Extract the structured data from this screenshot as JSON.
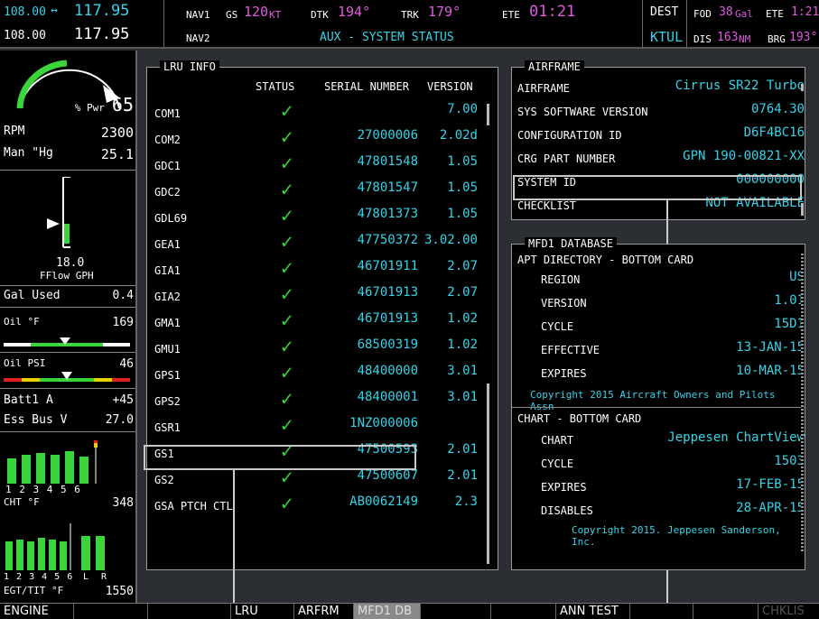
{
  "topbar": {
    "com_active_1": "108.00",
    "com_arrow": "↔",
    "com_standby_1": "117.95",
    "com_active_2": "108.00",
    "com_standby_2": "117.95",
    "nav1_label": "NAV1",
    "nav2_label": "NAV2",
    "gs_label": "GS",
    "gs_value": "120",
    "gs_unit": "KT",
    "dtk_label": "DTK",
    "dtk_value": "194°",
    "trk_label": "TRK",
    "trk_value": "179°",
    "ete_label": "ETE",
    "ete_value": "01:21",
    "page_title": "AUX - SYSTEM STATUS",
    "dest_label": "DEST",
    "dest_value": "KTUL",
    "fod_label": "FOD",
    "fod_value": "38",
    "fod_unit": "Gal",
    "ete2_label": "ETE",
    "ete2_value": "1:21",
    "dis_label": "DIS",
    "dis_value": "163",
    "dis_unit": "NM",
    "brg_label": "BRG",
    "brg_value": "193°"
  },
  "engine": {
    "pwr_label": "% Pwr",
    "pwr_value": "65",
    "rpm_label": "RPM",
    "rpm_value": "2300",
    "man_label": "Man \"Hg",
    "man_value": "25.1",
    "fflow_value": "18.0",
    "fflow_label": "FFlow GPH",
    "gal_used_label": "Gal Used",
    "gal_used_value": "0.4",
    "oil_f_label": "Oil °F",
    "oil_f_value": "169",
    "oil_psi_label": "Oil PSI",
    "oil_psi_value": "46",
    "batt_label": "Batt1 A",
    "batt_value": "+45",
    "ess_label": "Ess Bus V",
    "ess_value": "27.0",
    "cyl_labels": "1 2 3 4 5 6",
    "cht_label": "CHT °F",
    "cht_value": "348",
    "egt_cyl_labels": "1 2 3 4 5 6",
    "egt_lr": "L R",
    "egt_label": "EGT/TIT °F",
    "egt_value": "1550"
  },
  "lru": {
    "title": "LRU INFO",
    "col_status": "STATUS",
    "col_serial": "SERIAL NUMBER",
    "col_version": "VERSION",
    "check": "✓",
    "rows": [
      {
        "name": "COM1",
        "serial": "",
        "version": "7.00"
      },
      {
        "name": "COM2",
        "serial": "27000006",
        "version": "2.02d"
      },
      {
        "name": "GDC1",
        "serial": "47801548",
        "version": "1.05"
      },
      {
        "name": "GDC2",
        "serial": "47801547",
        "version": "1.05"
      },
      {
        "name": "GDL69",
        "serial": "47801373",
        "version": "1.05"
      },
      {
        "name": "GEA1",
        "serial": "47750372",
        "version": "3.02.00"
      },
      {
        "name": "GIA1",
        "serial": "46701911",
        "version": "2.07"
      },
      {
        "name": "GIA2",
        "serial": "46701913",
        "version": "2.07"
      },
      {
        "name": "GMA1",
        "serial": "46701913",
        "version": "1.02"
      },
      {
        "name": "GMU1",
        "serial": "68500319",
        "version": "1.02"
      },
      {
        "name": "GPS1",
        "serial": "48400000",
        "version": "3.01"
      },
      {
        "name": "GPS2",
        "serial": "48400001",
        "version": "3.01"
      },
      {
        "name": "GSR1",
        "serial": "1NZ000006",
        "version": ""
      },
      {
        "name": "GS1",
        "serial": "47500593",
        "version": "2.01"
      },
      {
        "name": "GS2",
        "serial": "47500607",
        "version": "2.01"
      },
      {
        "name": "GSA PTCH CTL",
        "serial": "AB0062149",
        "version": "2.3"
      }
    ]
  },
  "airframe": {
    "title": "AIRFRAME",
    "rows": [
      {
        "key": "AIRFRAME",
        "value": "Cirrus SR22 Turbo"
      },
      {
        "key": "SYS SOFTWARE VERSION",
        "value": "0764.30"
      },
      {
        "key": "CONFIGURATION ID",
        "value": "D6F4BC16"
      },
      {
        "key": "CRG PART NUMBER",
        "value": "GPN 190-00821-XX"
      },
      {
        "key": "SYSTEM ID",
        "value": "000000000"
      },
      {
        "key": "CHECKLIST",
        "value": "NOT AVAILABLE"
      }
    ]
  },
  "mfd_db": {
    "title": "MFD1 DATABASE",
    "apt_header": "APT DIRECTORY - BOTTOM CARD",
    "apt_rows": [
      {
        "key": "REGION",
        "value": "US"
      },
      {
        "key": "VERSION",
        "value": "1.01"
      },
      {
        "key": "CYCLE",
        "value": "15D1"
      },
      {
        "key": "EFFECTIVE",
        "value": "13-JAN-15"
      },
      {
        "key": "EXPIRES",
        "value": "10-MAR-15"
      }
    ],
    "apt_copyright": "Copyright 2015 Aircraft Owners and Pilots Assn",
    "chart_header": "CHART - BOTTOM CARD",
    "chart_rows": [
      {
        "key": "CHART",
        "value": "Jeppesen ChartView"
      },
      {
        "key": "CYCLE",
        "value": "1503"
      },
      {
        "key": "EXPIRES",
        "value": "17-FEB-15"
      },
      {
        "key": "DISABLES",
        "value": "28-APR-15"
      }
    ],
    "chart_copyright": "Copyright 2015. Jeppesen Sanderson, Inc."
  },
  "softkeys": {
    "engine": "ENGINE",
    "lru": "LRU",
    "arfrm": "ARFRM",
    "mfd1db": "MFD1 DB",
    "anntest": "ANN TEST",
    "chklis": "CHKLIS"
  }
}
